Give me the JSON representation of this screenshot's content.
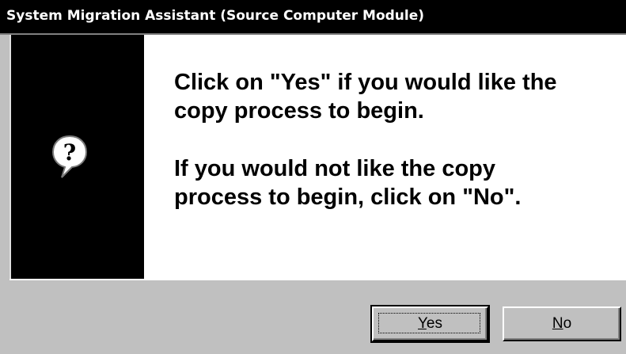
{
  "window": {
    "title": "System Migration Assistant (Source Computer Module)"
  },
  "dialog": {
    "icon": "question-icon",
    "message_line1": "Click on \"Yes\" if you would like the",
    "message_line2": "copy process to begin.",
    "message_line3": "If you would not like the copy",
    "message_line4": "process to begin, click on \"No\"."
  },
  "buttons": {
    "yes": {
      "mnemonic": "Y",
      "rest": "es"
    },
    "no": {
      "mnemonic": "N",
      "rest": "o"
    }
  },
  "colors": {
    "face": "#c0c0c0",
    "title_bar": "#000000",
    "title_text": "#ffffff",
    "content_bg": "#ffffff",
    "icon_panel": "#000000"
  }
}
